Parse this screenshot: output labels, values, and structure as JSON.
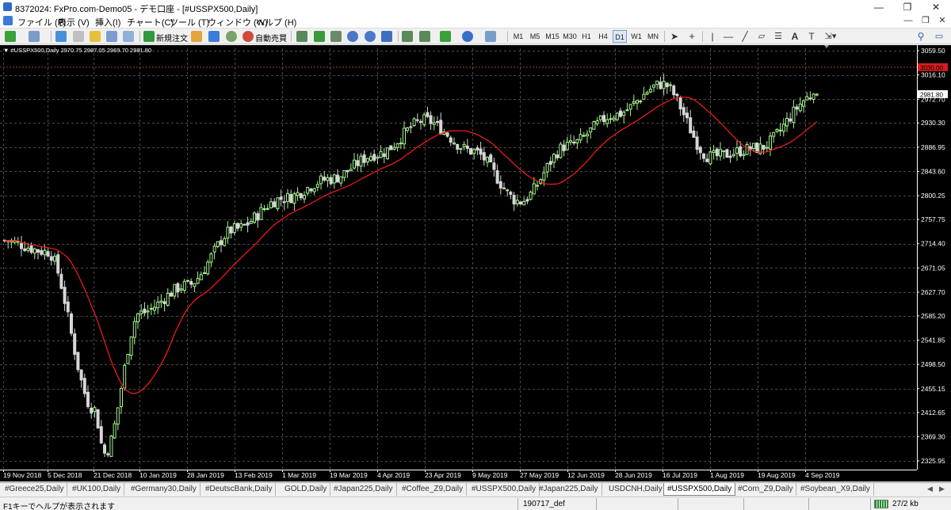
{
  "window": {
    "title": "8372024: FxPro.com-Demo05 - デモ口座 - [#USSPX500,Daily]",
    "controls": [
      "—",
      "❐",
      "✕"
    ]
  },
  "menu": {
    "items": [
      "ファイル (F)",
      "表示 (V)",
      "挿入(I)",
      "チャート(C)",
      "ツール (T)",
      "ウィンドウ (W)",
      "ヘルプ (H)"
    ],
    "window_controls": [
      "—",
      "❐",
      "✕"
    ]
  },
  "toolbar": {
    "new_order_label": "新規注文",
    "autotrade_label": "自動売買",
    "timeframes": [
      "M1",
      "M5",
      "M15",
      "M30",
      "H1",
      "H4",
      "D1",
      "W1",
      "MN"
    ],
    "active_timeframe": "D1"
  },
  "chart": {
    "info_line": "▼ #USSPX500,Daily  2970.75 2987.05 2969.70 2981.80",
    "current_price_label": "2981.80",
    "alert_line_label": "3030.00",
    "colors": {
      "background": "#000000",
      "bull_candle": "#a6f58e",
      "bear_candle": "#d6d6d6",
      "moving_average": "#ff1a1a",
      "grid": "#4a4a4a",
      "alert_line": "#c83232",
      "axis_text": "#ffffff"
    }
  },
  "chart_data": {
    "type": "candlestick",
    "symbol": "#USSPX500",
    "period": "Daily",
    "ohlc_last": {
      "open": 2970.75,
      "high": 2987.05,
      "low": 2969.7,
      "close": 2981.8
    },
    "y_ticks": [
      "3059.50",
      "3016.10",
      "2972.70",
      "2930.30",
      "2886.95",
      "2843.60",
      "2800.25",
      "2757.75",
      "2714.40",
      "2671.05",
      "2627.70",
      "2585.20",
      "2541.85",
      "2498.50",
      "2455.15",
      "2412.65",
      "2369.30",
      "2325.95"
    ],
    "x_ticks": [
      "19 Nov 2018",
      "5 Dec 2018",
      "21 Dec 2018",
      "10 Jan 2019",
      "28 Jan 2019",
      "13 Feb 2019",
      "1 Mar 2019",
      "19 Mar 2019",
      "4 Apr 2019",
      "23 Apr 2019",
      "9 May 2019",
      "27 May 2019",
      "12 Jun 2019",
      "28 Jun 2019",
      "16 Jul 2019",
      "1 Aug 2019",
      "19 Aug 2019",
      "4 Sep 2019"
    ],
    "ylim": [
      2312,
      3066
    ],
    "keypoints": [
      {
        "date": "19 Nov 2018",
        "close": 2720
      },
      {
        "date": "5 Dec 2018",
        "close": 2700
      },
      {
        "date": "21 Dec 2018",
        "close": 2420
      },
      {
        "date": "26 Dec 2018",
        "close": 2340
      },
      {
        "date": "10 Jan 2019",
        "close": 2590
      },
      {
        "date": "28 Jan 2019",
        "close": 2640
      },
      {
        "date": "13 Feb 2019",
        "close": 2740
      },
      {
        "date": "1 Mar 2019",
        "close": 2795
      },
      {
        "date": "19 Mar 2019",
        "close": 2830
      },
      {
        "date": "4 Apr 2019",
        "close": 2875
      },
      {
        "date": "23 Apr 2019",
        "close": 2935
      },
      {
        "date": "9 May 2019",
        "close": 2880
      },
      {
        "date": "27 May 2019",
        "close": 2790
      },
      {
        "date": "12 Jun 2019",
        "close": 2890
      },
      {
        "date": "28 Jun 2019",
        "close": 2945
      },
      {
        "date": "16 Jul 2019",
        "close": 3000
      },
      {
        "date": "1 Aug 2019",
        "close": 2870
      },
      {
        "date": "19 Aug 2019",
        "close": 2885
      },
      {
        "date": "4 Sep 2019",
        "close": 2981.8
      }
    ]
  },
  "tabs": {
    "items": [
      "#Greece25,Daily",
      "#UK100,Daily",
      "#Germany30,Daily",
      "#DeutscBank,Daily",
      "GOLD,Daily",
      "#Japan225,Daily",
      "#Coffee_Z9,Daily",
      "#USSPX500,Daily",
      "#Japan225,Daily",
      "USDCNH,Daily",
      "#USSPX500,Daily",
      "#Corn_Z9,Daily",
      "#Soybean_X9,Daily"
    ],
    "active_index": 10,
    "arrows": [
      "◀",
      "▶"
    ]
  },
  "status": {
    "help_text": "F1キーでヘルプが表示されます",
    "profile": "190717_def",
    "traffic": "27/2 kb"
  }
}
